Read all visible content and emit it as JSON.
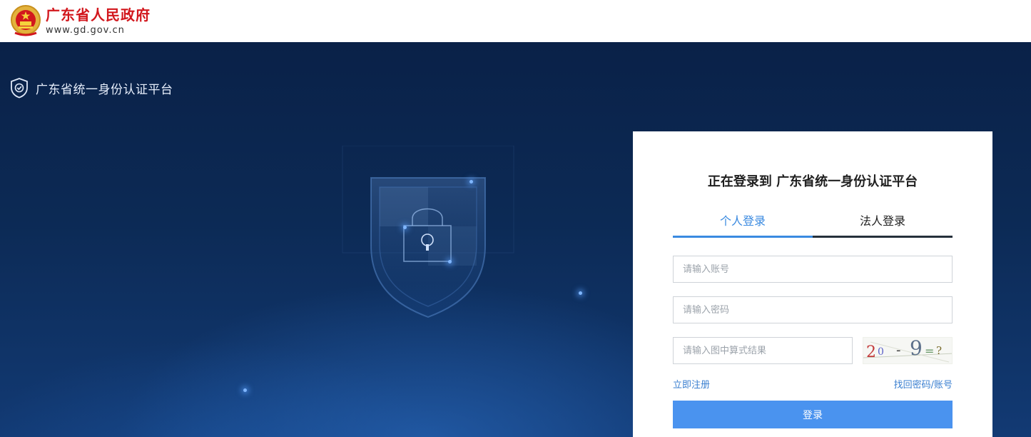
{
  "header": {
    "title": "广东省人民政府",
    "url": "www.gd.gov.cn",
    "logo_icon": "national-emblem-icon"
  },
  "hero": {
    "platform_name": "广东省统一身份认证平台",
    "badge_icon": "shield-check-icon",
    "art_icon": "shield-lock-icon"
  },
  "login": {
    "title": "正在登录到 广东省统一身份认证平台",
    "tabs": [
      {
        "label": "个人登录",
        "active": true
      },
      {
        "label": "法人登录",
        "active": false
      }
    ],
    "account_placeholder": "请输入账号",
    "password_placeholder": "请输入密码",
    "captcha_placeholder": "请输入图中算式结果",
    "captcha_text": "20-9=?",
    "register_link": "立即注册",
    "recover_link": "找回密码/账号",
    "submit_label": "登录"
  },
  "colors": {
    "brand_red": "#d2171d",
    "accent_blue": "#3a8ae0",
    "button_blue": "#4a93ef",
    "hero_bg": "#0c2a55"
  }
}
